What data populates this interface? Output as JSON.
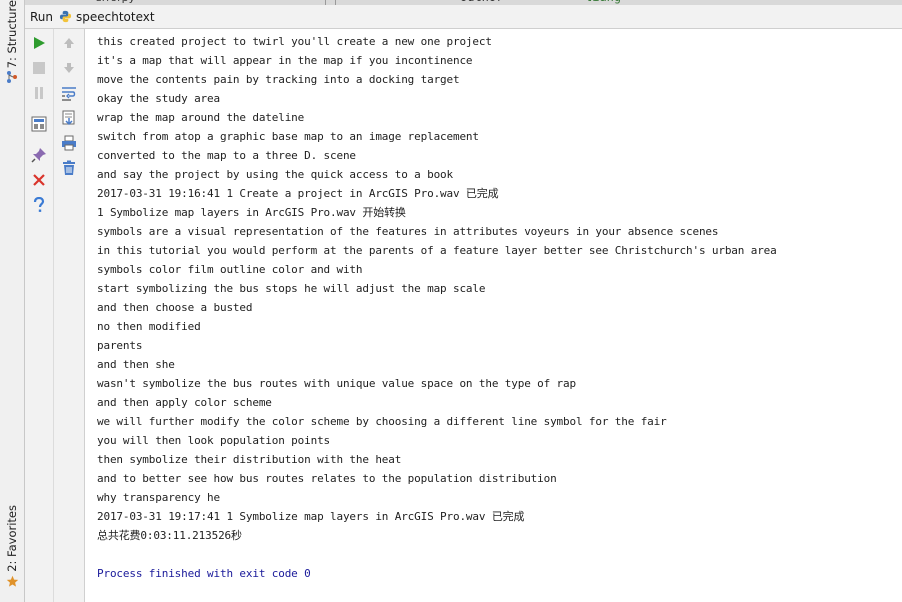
{
  "editor_tabs": {
    "file_tab": "errorpy",
    "code_fragment_a": "outhor",
    "code_fragment_b": "liang"
  },
  "tool_windows": {
    "structure": {
      "number": "7",
      "label": "7: Structure"
    },
    "favorites": {
      "number": "2",
      "label": "2: Favorites"
    }
  },
  "run_panel": {
    "title": "Run",
    "config_name": "speechtotext"
  },
  "toolbar_left": [
    {
      "icon": "run-icon",
      "color": "#2e9b2e"
    },
    {
      "icon": "stop-icon",
      "color": "#c8c8c8"
    },
    {
      "icon": "pause-icon",
      "color": "#c8c8c8"
    },
    {
      "icon": "restore-layout-icon"
    },
    {
      "icon": "pin-icon"
    },
    {
      "icon": "close-icon",
      "color": "#d9342b"
    },
    {
      "icon": "help-icon",
      "color": "#3b7bd4"
    }
  ],
  "toolbar_right": [
    {
      "icon": "up-arrow-icon"
    },
    {
      "icon": "down-arrow-icon"
    },
    {
      "icon": "soft-wrap-icon"
    },
    {
      "icon": "scroll-to-end-icon"
    },
    {
      "icon": "print-icon"
    },
    {
      "icon": "trash-icon"
    }
  ],
  "console": {
    "lines": [
      "this created project to twirl you'll create a new one project",
      "it's a map that will appear in the map if you incontinence",
      "move the contents pain by tracking into a docking target",
      "okay the study area",
      "wrap the map around the dateline",
      "switch from atop a graphic base map to an image replacement",
      "converted to the map to a three D. scene",
      "and say the project by using the quick access to a book",
      "2017-03-31 19:16:41 1 Create a project in ArcGIS Pro.wav 已完成",
      "1 Symbolize map layers in ArcGIS Pro.wav 开始转换",
      "symbols are a visual representation of the features in attributes voyeurs in your absence scenes",
      "in this tutorial you would perform at the parents of a feature layer better see Christchurch's urban area",
      "symbols color film outline color and with",
      "start symbolizing the bus stops he will adjust the map scale",
      "and then choose a busted",
      "no then modified",
      "parents",
      "and then she",
      "wasn't symbolize the bus routes with unique value space on the type of rap",
      "and then apply color scheme",
      "we will further modify the color scheme by choosing a different line symbol for the fair",
      "you will then look population points",
      "then symbolize their distribution with the heat",
      "and to better see how bus routes relates to the population distribution",
      "why transparency he",
      "2017-03-31 19:17:41 1 Symbolize map layers in ArcGIS Pro.wav 已完成",
      "总共花费0:03:11.213526秒",
      "",
      "Process finished with exit code 0"
    ]
  }
}
